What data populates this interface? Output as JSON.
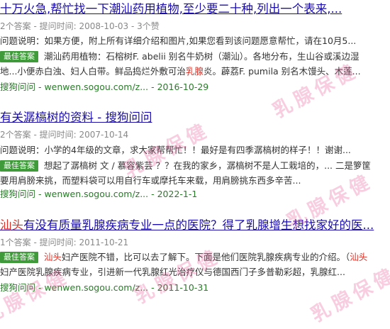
{
  "results": [
    {
      "title_pre": "十万火急,帮忙找一下潮汕药用植物,至少要二十种,列出一个表来,...",
      "meta": "2个答案 - 提问时间: 2008-10-03 - 3个赞",
      "desc_label": "问题说明：",
      "desc": "如果方便，附上所有详细介绍和图片,如果您看到该问题愿意帮忙，请在10月5...",
      "badge": "最佳答案",
      "answer_1": "潮汕药用植物：石榕树F. abelii 别名牛奶树（潮汕）。各地分布，生山谷或溪边湿",
      "answer_2a": "地...小便赤白浊、妇人白带。鲜品捣烂外敷可治",
      "answer_2hl": "乳腺",
      "answer_2b": "炎。薜荔F. pumila 别名木馒头、木莲...",
      "source": "搜狗问问 - wenwen.sogou.com/z... - 2016-10-29"
    },
    {
      "title_pre": "有关潺槁树的资料 - 搜狗问问",
      "meta": "2个答案 - 提问时间: 2007-10-14",
      "desc_label": "问题说明：",
      "desc": "小学的4年级的文章，求大家帮帮忙！！最好是有四季潺槁树的样子！！谢谢...",
      "badge": "最佳答案",
      "answer_1": "想起了潺槁树 文 / 慕容紫芸 ？？在我的家乡，潺槁树不是人工栽培的，... 二是箩筐",
      "answer_2a": "要用肩膀来挑，而塑料袋可以用自行车或摩托车来载，用肩膀挑东西多辛苦...",
      "answer_2hl": "",
      "answer_2b": "",
      "source": "搜狗问问 - wenwen.sogou.com/z... - 2022-1-1"
    },
    {
      "title_red": "汕头",
      "title_pre": "有没有质量乳腺疾病专业一点的医院？得了乳腺增生想找家好的医...",
      "meta": "1个答案 - 提问时间: 2011-10-21",
      "badge": "最佳答案",
      "answer_1hl": "汕头",
      "answer_1": "妇产医院不错，比可以去了解下。下面是他们医院乳腺疾病专业的介绍。（",
      "answer_1hl2": "汕头",
      "answer_2a": "妇产医院乳腺疾病专业，引进新一代乳腺红光治疗仪与德国西门子多普勒彩超，乳腺红...",
      "source": "搜狗问问 - wenwen.sogou.com/z... - 2011-10-31"
    }
  ],
  "watermark": "乳腺保健"
}
